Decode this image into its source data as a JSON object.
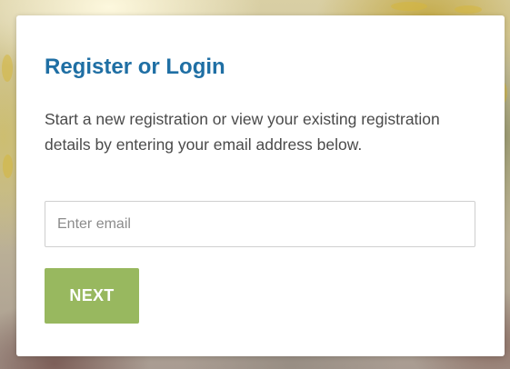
{
  "card": {
    "title": "Register or Login",
    "description": "Start a new registration or view your existing registration details by entering your email address below."
  },
  "email": {
    "placeholder": "Enter email",
    "value": ""
  },
  "actions": {
    "next_label": "NEXT"
  },
  "colors": {
    "title": "#1f6fa4",
    "button": "#98b85f",
    "text": "#4a4a4a"
  }
}
